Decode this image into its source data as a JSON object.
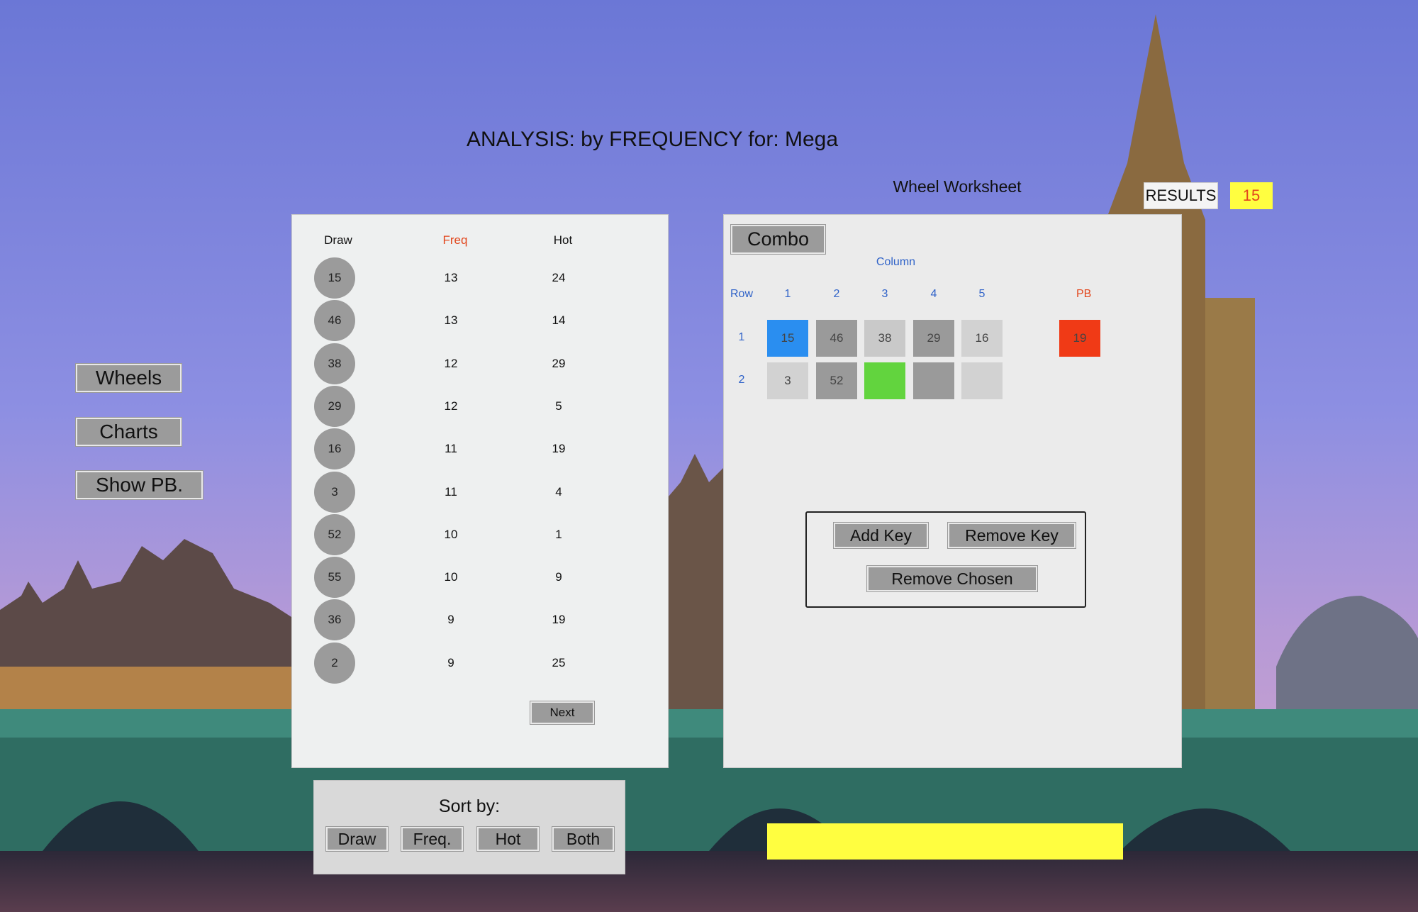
{
  "title": "ANALYSIS: by FREQUENCY for: Mega",
  "worksheet_title": "Wheel Worksheet",
  "results": {
    "label": "RESULTS",
    "value": "15"
  },
  "nav": {
    "wheels": "Wheels",
    "charts": "Charts",
    "show_pb": "Show PB."
  },
  "freq_table": {
    "headers": {
      "draw": "Draw",
      "freq": "Freq",
      "hot": "Hot"
    },
    "rows": [
      {
        "draw": "15",
        "freq": "13",
        "hot": "24"
      },
      {
        "draw": "46",
        "freq": "13",
        "hot": "14"
      },
      {
        "draw": "38",
        "freq": "12",
        "hot": "29"
      },
      {
        "draw": "29",
        "freq": "12",
        "hot": "5"
      },
      {
        "draw": "16",
        "freq": "11",
        "hot": "19"
      },
      {
        "draw": "3",
        "freq": "11",
        "hot": "4"
      },
      {
        "draw": "52",
        "freq": "10",
        "hot": "1"
      },
      {
        "draw": "55",
        "freq": "10",
        "hot": "9"
      },
      {
        "draw": "36",
        "freq": "9",
        "hot": "19"
      },
      {
        "draw": "2",
        "freq": "9",
        "hot": "25"
      }
    ],
    "next_label": "Next"
  },
  "worksheet": {
    "combo_label": "Combo",
    "column_label": "Column",
    "row_label": "Row",
    "col_labels": [
      "1",
      "2",
      "3",
      "4",
      "5"
    ],
    "pb_label": "PB",
    "rows": [
      {
        "label": "1",
        "cells": [
          {
            "value": "15",
            "color": "#2a8ef0"
          },
          {
            "value": "46",
            "color": "#9a9a9a"
          },
          {
            "value": "38",
            "color": "#c9c9c9"
          },
          {
            "value": "29",
            "color": "#9a9a9a"
          },
          {
            "value": "16",
            "color": "#d2d2d2"
          }
        ],
        "pb": {
          "value": "19",
          "color": "#f03a16"
        }
      },
      {
        "label": "2",
        "cells": [
          {
            "value": "3",
            "color": "#d2d2d2"
          },
          {
            "value": "52",
            "color": "#9a9a9a"
          },
          {
            "value": "",
            "color": "#62d43e"
          },
          {
            "value": "",
            "color": "#9a9a9a"
          },
          {
            "value": "",
            "color": "#d2d2d2"
          }
        ]
      }
    ],
    "add_key": "Add Key",
    "remove_key": "Remove Key",
    "remove_chosen": "Remove Chosen"
  },
  "sort": {
    "title": "Sort by:",
    "draw": "Draw",
    "freq": "Freq.",
    "hot": "Hot",
    "both": "Both"
  },
  "colors": {
    "accent_yellow": "#fffe40",
    "pb_red": "#f03a16",
    "highlight_blue": "#2a8ef0",
    "chosen_green": "#62d43e"
  }
}
